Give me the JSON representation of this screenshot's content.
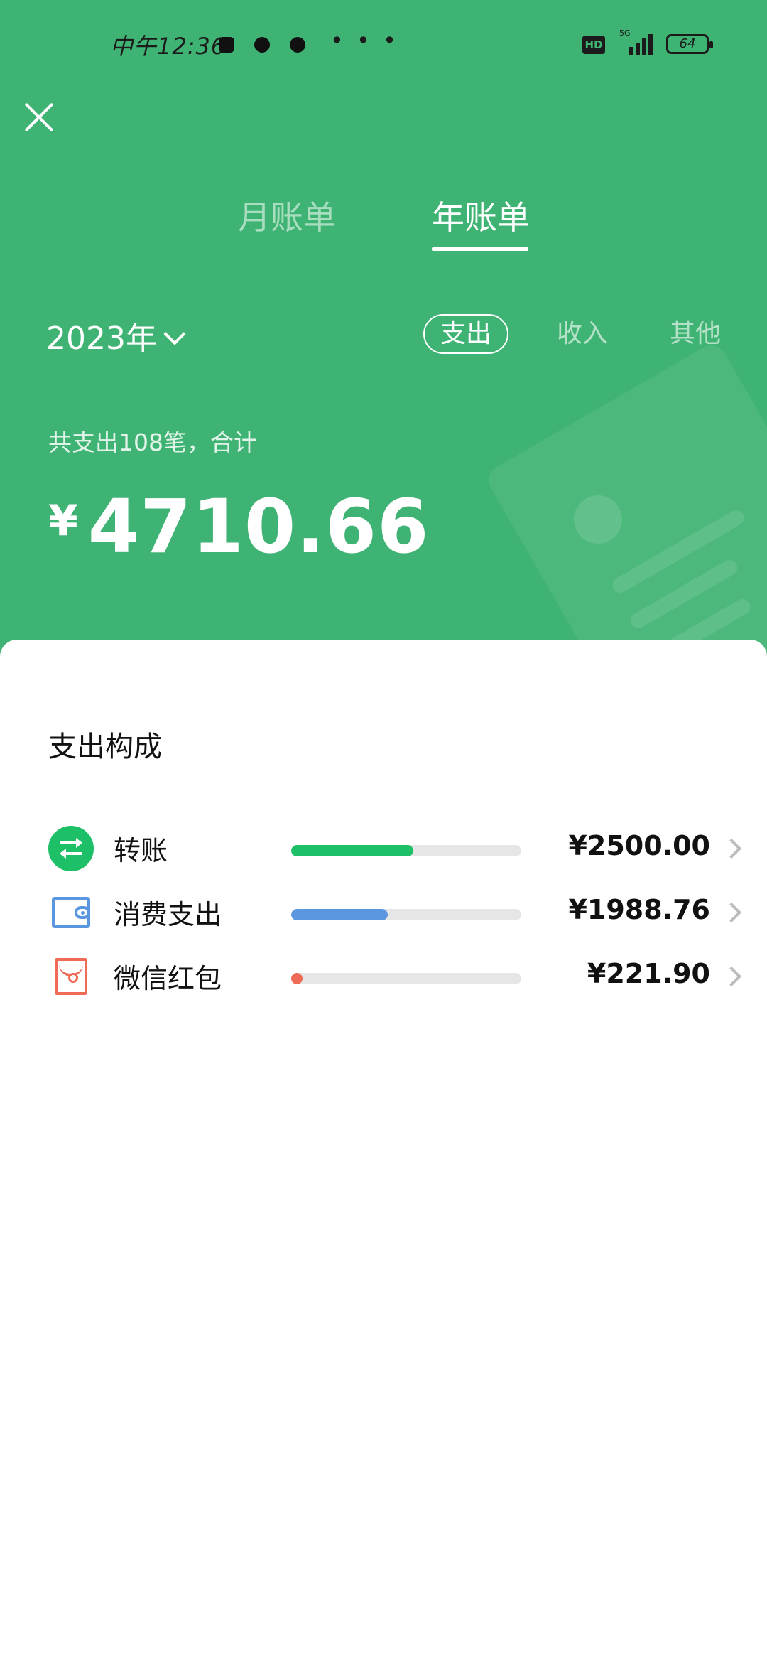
{
  "status_bar": {
    "time": "中午12:36",
    "network": "5G",
    "hd": "HD",
    "battery": "64",
    "more": "• • •"
  },
  "header": {
    "tabs": [
      {
        "label": "月账单",
        "active": false
      },
      {
        "label": "年账单",
        "active": true
      }
    ],
    "year": "2023年",
    "filters": [
      {
        "label": "支出",
        "active": true
      },
      {
        "label": "收入",
        "active": false
      },
      {
        "label": "其他",
        "active": false
      }
    ],
    "summary": "共支出108笔，合计",
    "currency": "¥",
    "total": "4710.66"
  },
  "breakdown": {
    "title": "支出构成",
    "items": [
      {
        "label": "转账",
        "amount": "¥2500.00",
        "share": 0.53,
        "color": "#1ec067",
        "icon": "transfer-icon"
      },
      {
        "label": "消费支出",
        "amount": "¥1988.76",
        "share": 0.42,
        "color": "#5b97e0",
        "icon": "wallet-icon"
      },
      {
        "label": "微信红包",
        "amount": "¥221.90",
        "share": 0.05,
        "color": "#ef6b57",
        "icon": "red-packet-icon"
      }
    ]
  },
  "colors": {
    "header_bg": "#3fb373",
    "sheet_bg": "#ffffff"
  }
}
